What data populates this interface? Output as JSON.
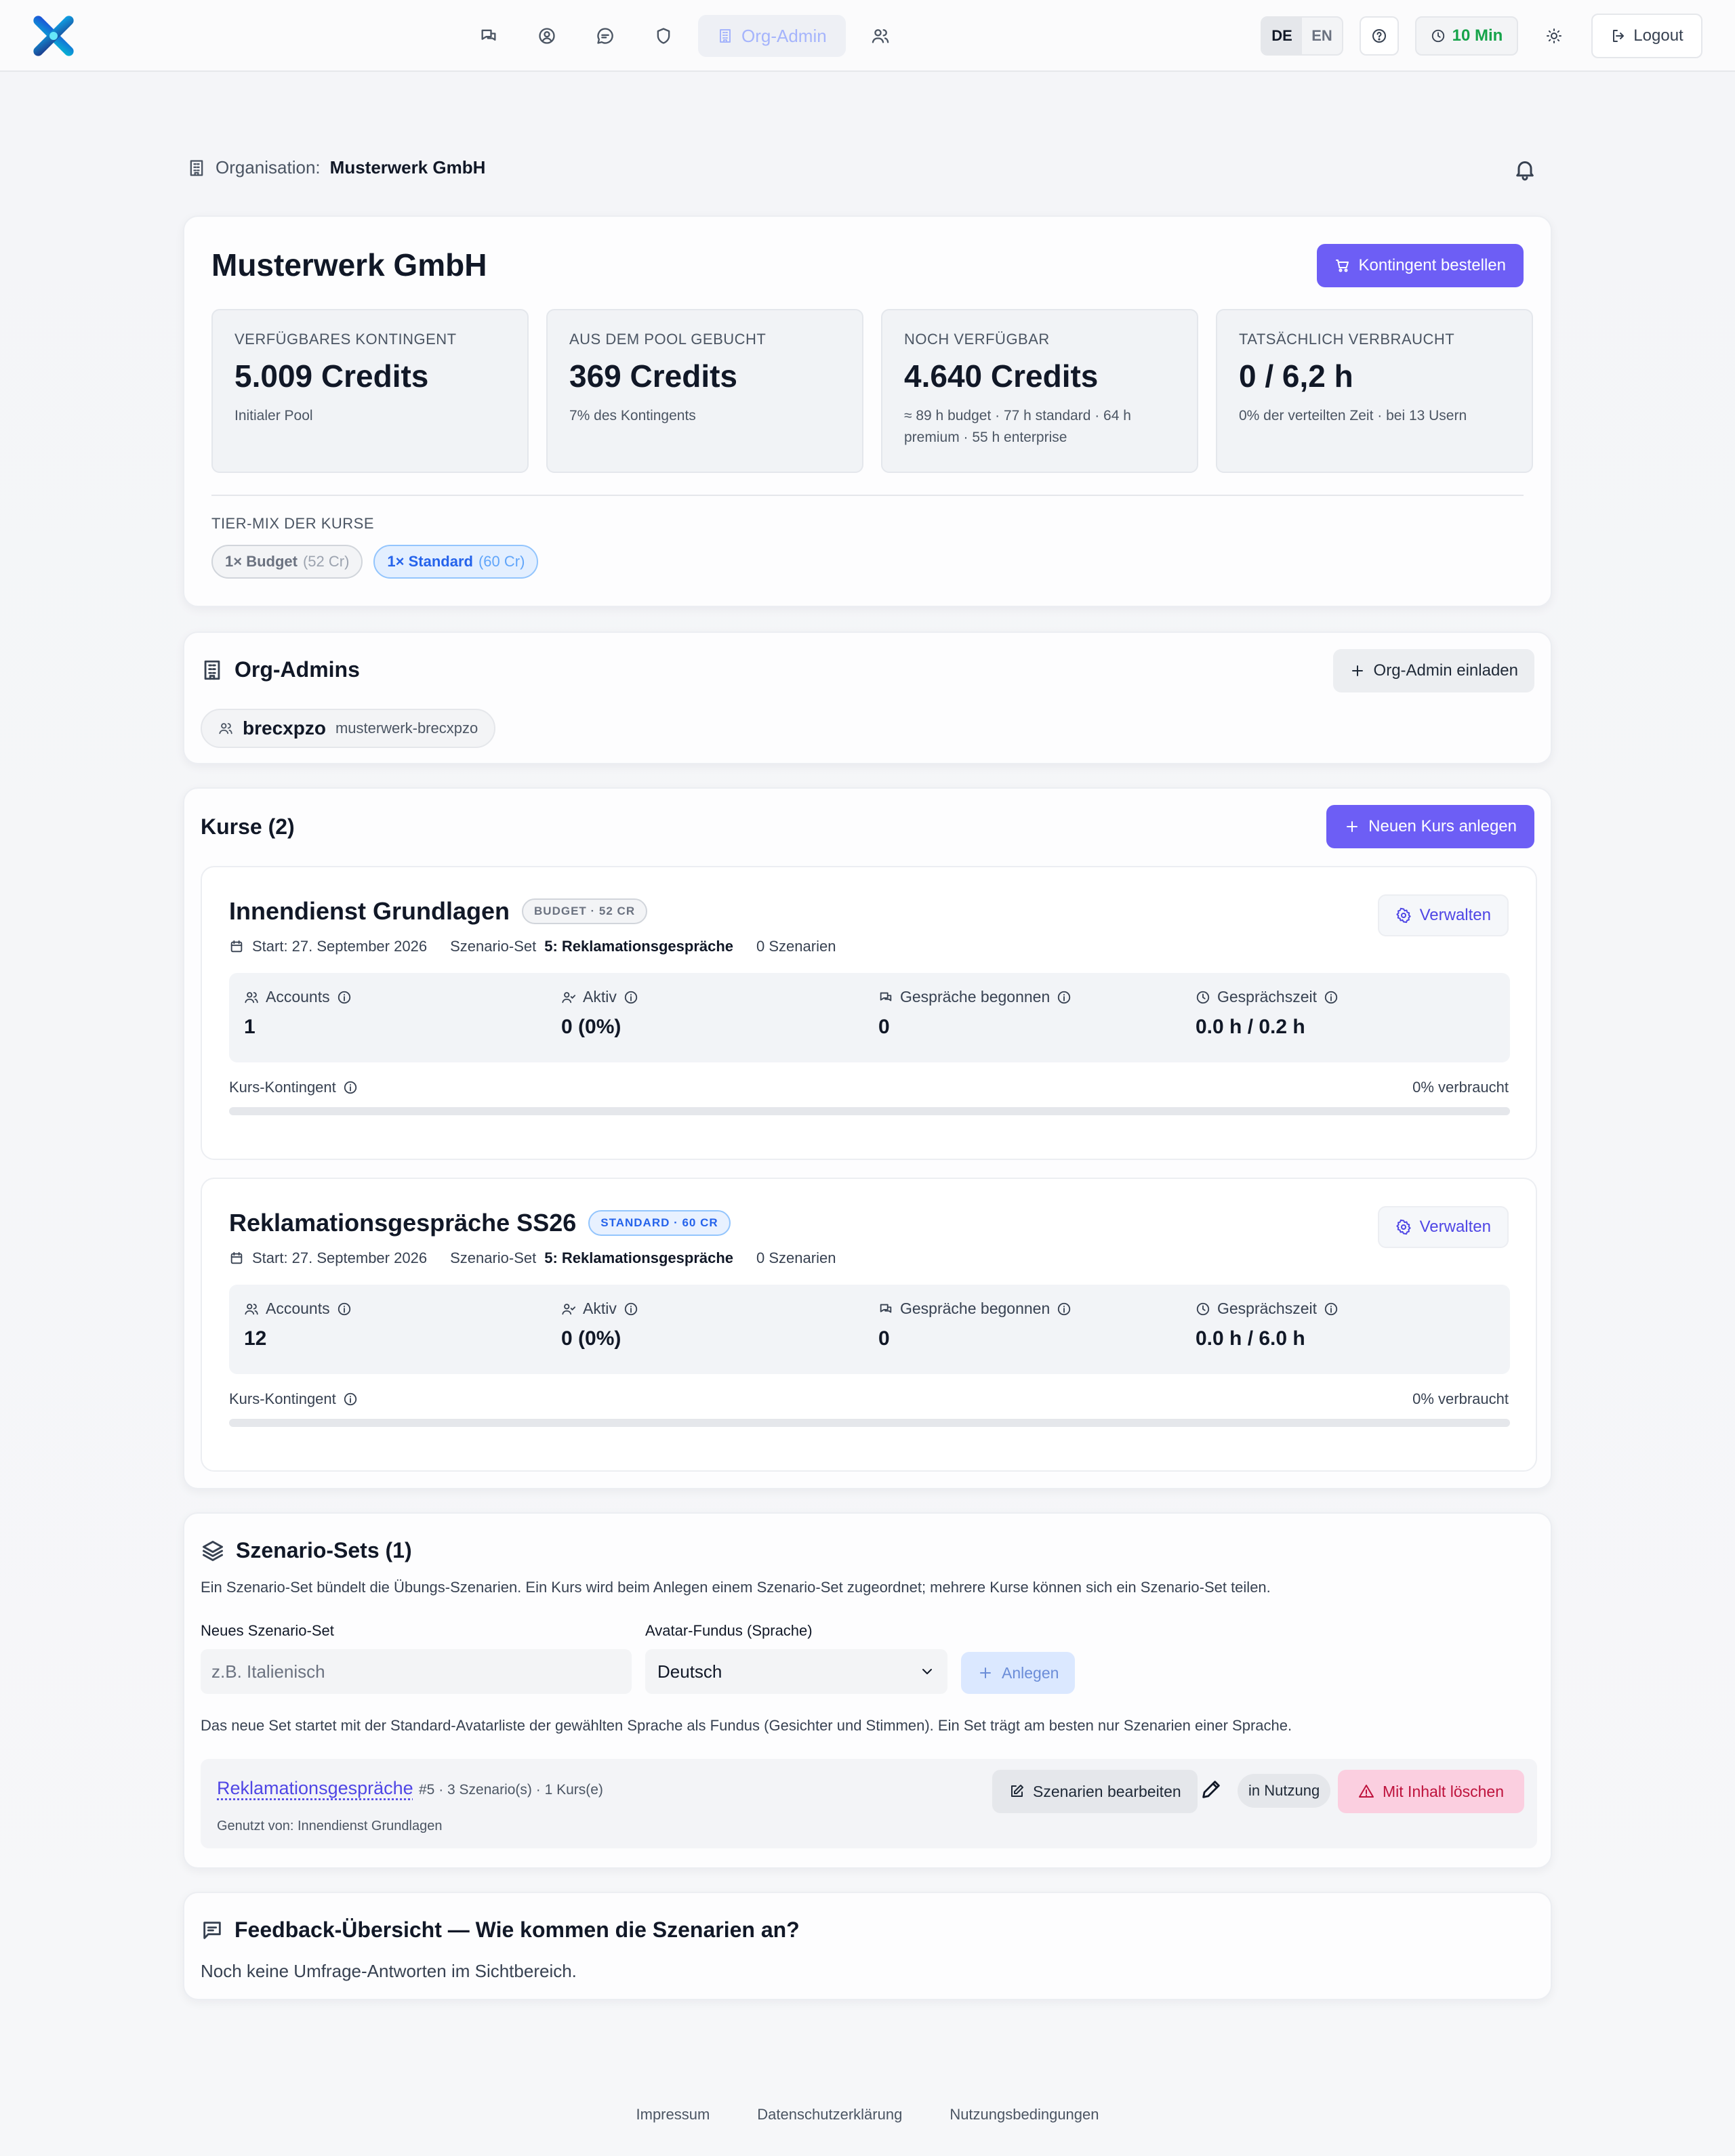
{
  "nav": {
    "items": [
      {
        "name": "chat-icon"
      },
      {
        "name": "user-circle-icon"
      },
      {
        "name": "message-icon"
      },
      {
        "name": "shield-icon"
      }
    ],
    "active_label": "Org-Admin",
    "users_icon": "users-icon"
  },
  "header": {
    "lang_de": "DE",
    "lang_en": "EN",
    "timer": "10 Min",
    "logout": "Logout"
  },
  "org": {
    "label": "Organisation:",
    "name": "Musterwerk GmbH"
  },
  "summary": {
    "title": "Musterwerk GmbH",
    "order_button": "Kontingent bestellen",
    "kpis": [
      {
        "label": "VERFÜGBARES KONTINGENT",
        "value": "5.009 Credits",
        "sub": "Initialer Pool"
      },
      {
        "label": "AUS DEM POOL GEBUCHT",
        "value": "369 Credits",
        "sub": "7% des Kontingents"
      },
      {
        "label": "NOCH VERFÜGBAR",
        "value": "4.640 Credits",
        "sub": "≈ 89 h budget · 77 h standard · 64 h premium · 55 h enterprise"
      },
      {
        "label": "TATSÄCHLICH VERBRAUCHT",
        "value": "0 / 6,2 h",
        "sub": "0% der verteilten Zeit · bei 13 Usern"
      }
    ],
    "tiermix_label": "TIER-MIX DER KURSE",
    "chips": [
      {
        "main": "1× Budget",
        "paren": "(52 Cr)"
      },
      {
        "main": "1× Standard",
        "paren": "(60 Cr)"
      }
    ]
  },
  "admins": {
    "title": "Org-Admins",
    "invite_button": "Org-Admin einladen",
    "list": [
      {
        "name": "brecxpzo",
        "slug": "musterwerk-brecxpzo"
      }
    ]
  },
  "courses": {
    "title": "Kurse (2)",
    "new_button": "Neuen Kurs anlegen",
    "items": [
      {
        "title": "Innendienst Grundlagen",
        "badge": "BUDGET · 52 CR",
        "start": "Start: 27. September 2026",
        "set_prefix": "Szenario-Set",
        "set_name": "5: Reklamationsgespräche",
        "scenarios": "0 Szenarien",
        "manage": "Verwalten",
        "stats": [
          {
            "label": "Accounts",
            "value": "1"
          },
          {
            "label": "Aktiv",
            "value": "0 (0%)"
          },
          {
            "label": "Gespräche begonnen",
            "value": "0"
          },
          {
            "label": "Gesprächszeit",
            "value": "0.0 h / 0.2 h"
          }
        ],
        "quota_label": "Kurs-Kontingent",
        "used": "0% verbraucht",
        "used_fraction": 0
      },
      {
        "title": "Reklamationsgespräche SS26",
        "badge": "STANDARD · 60 CR",
        "start": "Start: 27. September 2026",
        "set_prefix": "Szenario-Set",
        "set_name": "5: Reklamationsgespräche",
        "scenarios": "0 Szenarien",
        "manage": "Verwalten",
        "stats": [
          {
            "label": "Accounts",
            "value": "12"
          },
          {
            "label": "Aktiv",
            "value": "0 (0%)"
          },
          {
            "label": "Gespräche begonnen",
            "value": "0"
          },
          {
            "label": "Gesprächszeit",
            "value": "0.0 h / 6.0 h"
          }
        ],
        "quota_label": "Kurs-Kontingent",
        "used": "0% verbraucht",
        "used_fraction": 0
      }
    ]
  },
  "sets": {
    "title": "Szenario-Sets (1)",
    "description": "Ein Szenario-Set bündelt die Übungs-Szenarien. Ein Kurs wird beim Anlegen einem Szenario-Set zugeordnet; mehrere Kurse können sich ein Szenario-Set teilen.",
    "new_label": "Neues Szenario-Set",
    "new_placeholder": "z.B. Italienisch",
    "avatar_label": "Avatar-Fundus (Sprache)",
    "avatar_value": "Deutsch",
    "create_button": "Anlegen",
    "note": "Das neue Set startet mit der Standard-Avatarliste der gewählten Sprache als Fundus (Gesichter und Stimmen). Ein Set trägt am besten nur Szenarien einer Sprache.",
    "items": [
      {
        "name": "Reklamationsgespräche",
        "meta": "#5 · 3 Szenario(s) · 1 Kurs(e)",
        "used_by": "Genutzt von: Innendienst Grundlagen",
        "edit_button": "Szenarien bearbeiten",
        "status": "in Nutzung",
        "delete_button": "Mit Inhalt löschen"
      }
    ]
  },
  "feedback": {
    "title": "Feedback-Übersicht — Wie kommen die Szenarien an?",
    "empty": "Noch keine Umfrage-Antworten im Sichtbereich."
  },
  "footer": {
    "links": [
      "Impressum",
      "Datenschutzerklärung",
      "Nutzungsbedingungen"
    ]
  },
  "colors": {
    "accent": "#6d5ef5",
    "timer": "#16a34a",
    "danger_bg": "#fbcfe0",
    "danger_text": "#be123c"
  }
}
